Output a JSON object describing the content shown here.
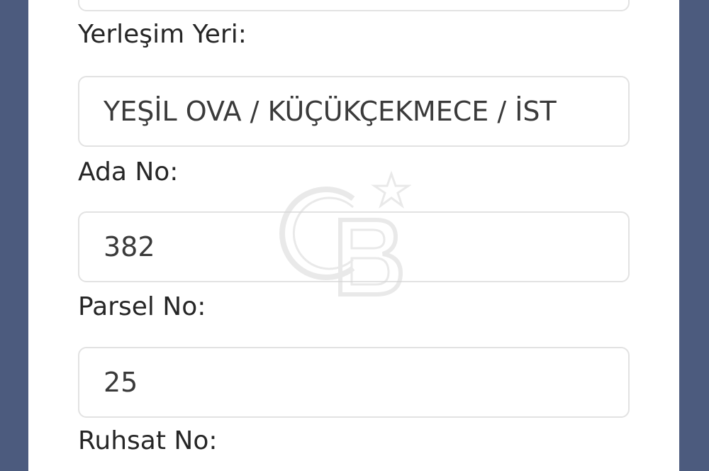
{
  "form": {
    "fields": [
      {
        "label": "Yerleşim Yeri:",
        "value": "YEŞİL OVA / KÜÇÜKÇEKMECE / İST"
      },
      {
        "label": "Ada No:",
        "value": "382"
      },
      {
        "label": "Parsel No:",
        "value": "25"
      },
      {
        "label": "Ruhsat No:",
        "value": ""
      }
    ]
  },
  "watermark": {
    "icon": "coldwell-banker-cb-logo-icon",
    "text": "CB"
  },
  "colors": {
    "background_frame": "#4c5b7e",
    "panel": "#ffffff",
    "input_border": "#e2e2e2",
    "label_text": "#262626",
    "value_text": "#3a3a3a"
  }
}
